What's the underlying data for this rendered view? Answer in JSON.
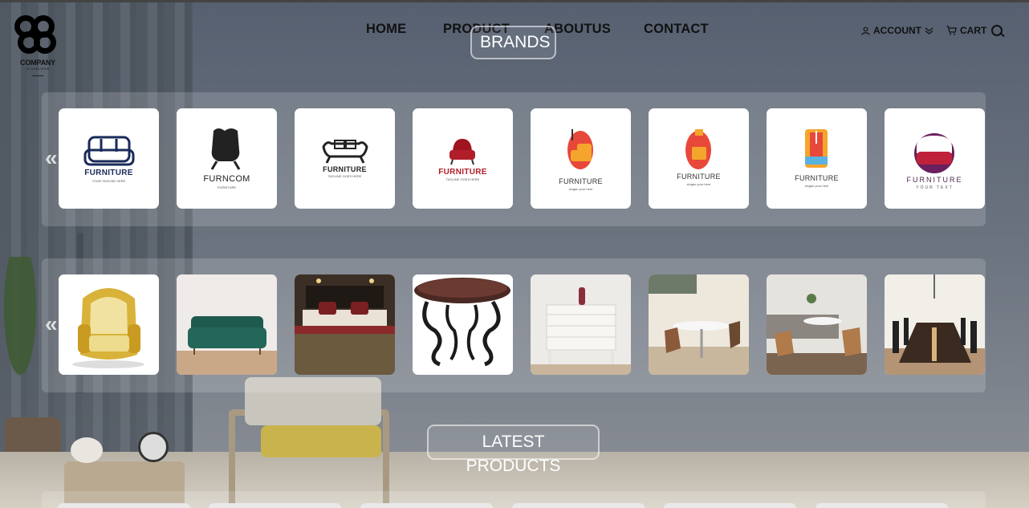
{
  "logo": {
    "name": "COMPANY",
    "tagline": "SLOGAN HERE"
  },
  "nav": {
    "home": "HOME",
    "product": "PRODUCT",
    "about": "ABOUTUS",
    "contact": "CONTACT"
  },
  "header": {
    "account_label": "ACCOUNT",
    "cart_label": "CART"
  },
  "sections": {
    "brands_title": "BRANDS",
    "latest_title": "LATEST PRODUCTS"
  },
  "brands": [
    {
      "name": "FURNITURE",
      "sub": "YOUR TAGLINE HERE",
      "color": "#1a2a5a"
    },
    {
      "name": "FURNCOM",
      "sub": "FURNITURE",
      "color": "#222222"
    },
    {
      "name": "FURNITURE",
      "sub": "TAGLINE GOES HERE",
      "color": "#222222"
    },
    {
      "name": "FURNITURE",
      "sub": "TAGLINE GOES HERE",
      "color": "#b01e2a"
    },
    {
      "name": "FURNITURE",
      "sub": "slogan your here",
      "color": "#333333"
    },
    {
      "name": "FURNITURE",
      "sub": "slogan your here",
      "color": "#333333"
    },
    {
      "name": "FURNITURE",
      "sub": "slogan your here",
      "color": "#333333"
    },
    {
      "name": "FURNITURE",
      "sub": "YOUR TEXT",
      "color": "#4a2a4a"
    }
  ],
  "products": [
    {
      "name": "armchair-gold",
      "icon": "golden-throne-chair"
    },
    {
      "name": "sofa-green",
      "icon": "green-velvet-sofa"
    },
    {
      "name": "bed-room",
      "icon": "bedroom-bed"
    },
    {
      "name": "round-table",
      "icon": "wrought-iron-table"
    },
    {
      "name": "dresser",
      "icon": "white-dresser"
    },
    {
      "name": "cafe-table",
      "icon": "dining-set"
    },
    {
      "name": "lounge",
      "icon": "living-room"
    },
    {
      "name": "dining",
      "icon": "long-dining-table"
    }
  ],
  "arrows": {
    "prev": "«",
    "next": "»"
  }
}
